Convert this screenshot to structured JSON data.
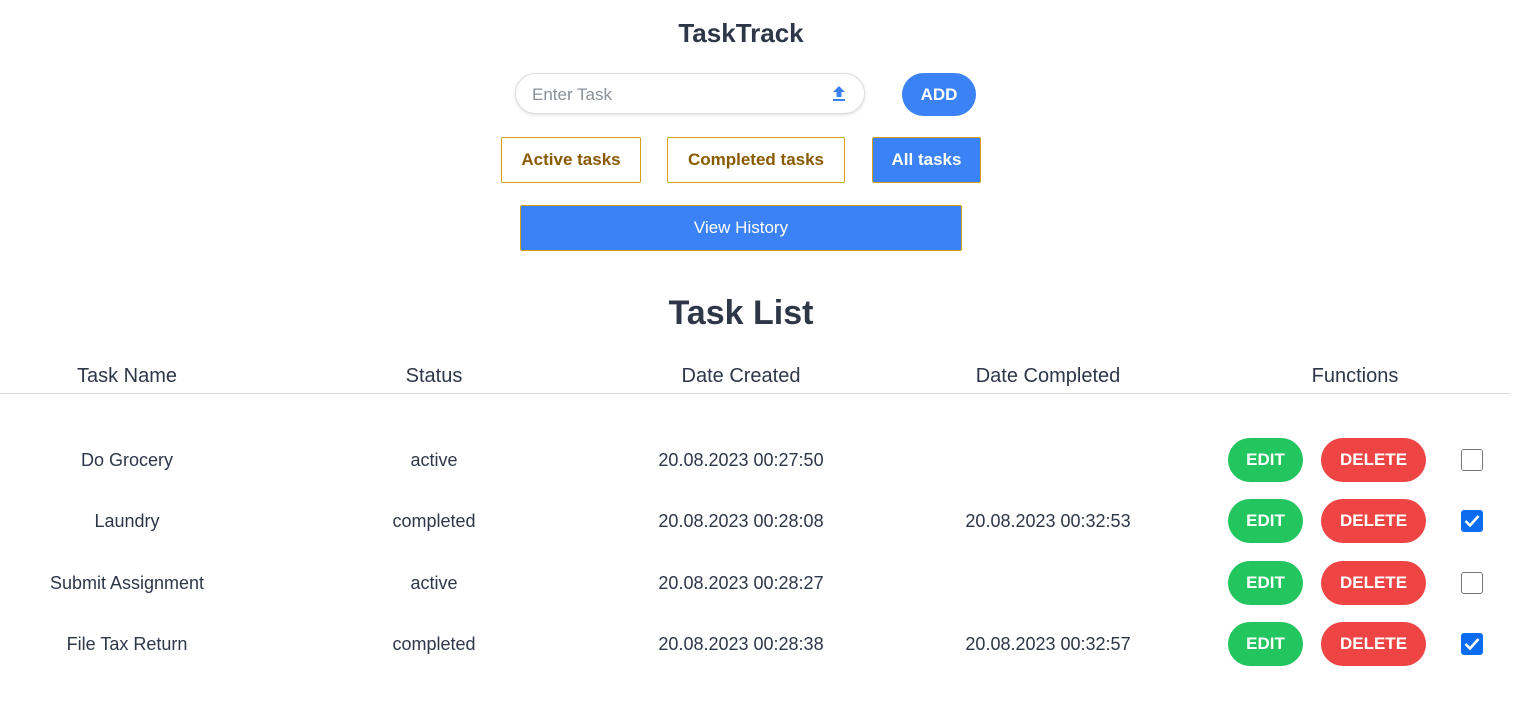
{
  "app": {
    "title": "TaskTrack"
  },
  "task_input": {
    "placeholder": "Enter Task",
    "value": ""
  },
  "add_button": {
    "label": "ADD"
  },
  "filters": [
    {
      "label": "Active tasks",
      "active": false
    },
    {
      "label": "Completed tasks",
      "active": false
    },
    {
      "label": "All tasks",
      "active": true
    }
  ],
  "history_button": {
    "label": "View History"
  },
  "task_list": {
    "title": "Task List",
    "columns": [
      "Task Name",
      "Status",
      "Date Created",
      "Date Completed",
      "Functions"
    ],
    "edit_label": "EDIT",
    "delete_label": "DELETE",
    "rows": [
      {
        "name": "Do Grocery",
        "status": "active",
        "created": "20.08.2023 00:27:50",
        "completed": "",
        "checked": false
      },
      {
        "name": "Laundry",
        "status": "completed",
        "created": "20.08.2023 00:28:08",
        "completed": "20.08.2023 00:32:53",
        "checked": true
      },
      {
        "name": "Submit Assignment",
        "status": "active",
        "created": "20.08.2023 00:28:27",
        "completed": "",
        "checked": false
      },
      {
        "name": "File Tax Return",
        "status": "completed",
        "created": "20.08.2023 00:28:38",
        "completed": "20.08.2023 00:32:57",
        "checked": true
      }
    ]
  },
  "colors": {
    "primary": "#3b82f6",
    "edit": "#22c55e",
    "delete": "#ef4444",
    "filter_border": "#d4a017",
    "filter_text": "#8a5a00",
    "checkbox_checked": "#0b6cf0"
  },
  "icons": {
    "input_action": "upload-icon"
  }
}
